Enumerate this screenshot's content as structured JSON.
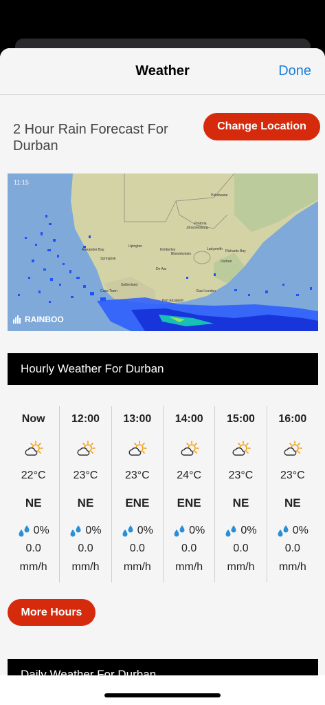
{
  "navbar": {
    "title": "Weather",
    "done_label": "Done"
  },
  "forecast": {
    "title": "2 Hour Rain Forecast For Durban",
    "change_location_label": "Change Location"
  },
  "map": {
    "time": "11:15",
    "logo": "RAINBOO",
    "places": [
      "Polokwane",
      "Pretoria",
      "Johannesburg",
      "Ladysmith",
      "Richards Bay",
      "Upington",
      "Kimberley",
      "Bloemfontein",
      "Durban",
      "Alexander Bay",
      "Springbok",
      "De Aar",
      "Sutherland",
      "Cape Town",
      "Port Elizabeth",
      "East London"
    ]
  },
  "hourly": {
    "title": "Hourly Weather For Durban",
    "hours": [
      {
        "time": "Now",
        "icon": "partly-sunny-icon",
        "temp": "22°C",
        "wind": "NE",
        "rain_chance": "0%",
        "rain_amount": "0.0",
        "rain_unit": "mm/h"
      },
      {
        "time": "12:00",
        "icon": "partly-sunny-icon",
        "temp": "23°C",
        "wind": "NE",
        "rain_chance": "0%",
        "rain_amount": "0.0",
        "rain_unit": "mm/h"
      },
      {
        "time": "13:00",
        "icon": "partly-sunny-icon",
        "temp": "23°C",
        "wind": "ENE",
        "rain_chance": "0%",
        "rain_amount": "0.0",
        "rain_unit": "mm/h"
      },
      {
        "time": "14:00",
        "icon": "partly-sunny-icon",
        "temp": "24°C",
        "wind": "ENE",
        "rain_chance": "0%",
        "rain_amount": "0.0",
        "rain_unit": "mm/h"
      },
      {
        "time": "15:00",
        "icon": "partly-sunny-icon",
        "temp": "23°C",
        "wind": "NE",
        "rain_chance": "0%",
        "rain_amount": "0.0",
        "rain_unit": "mm/h"
      },
      {
        "time": "16:00",
        "icon": "partly-sunny-icon",
        "temp": "23°C",
        "wind": "NE",
        "rain_chance": "0%",
        "rain_amount": "0.0",
        "rain_unit": "mm/h"
      }
    ],
    "more_hours_label": "More Hours"
  },
  "daily": {
    "title": "Daily Weather For Durban"
  },
  "colors": {
    "accent_red": "#d52a0b",
    "link_blue": "#1a7fd9",
    "header_black": "#000000",
    "sun": "#f39c12",
    "rain_drop": "#2a8fd6"
  }
}
